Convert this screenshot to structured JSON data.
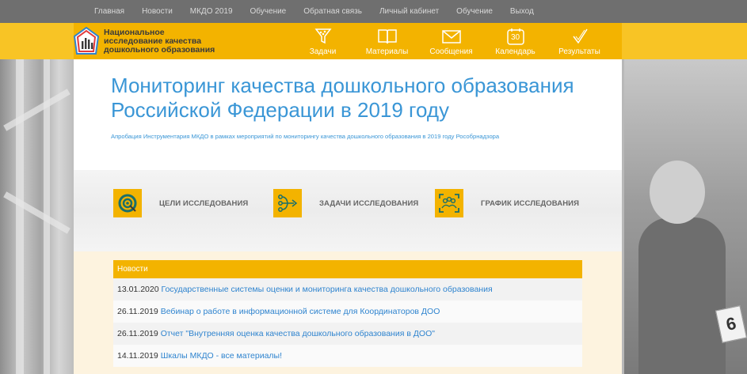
{
  "nav": {
    "links": [
      "Главная",
      "Новости",
      "МКДО 2019",
      "Обучение",
      "Обратная связь",
      "Личный кабинет",
      "Обучение",
      "Выход"
    ]
  },
  "header": {
    "logo_lines": [
      "Национальное",
      "исследование качества",
      "дошкольного образования"
    ],
    "tabs": [
      {
        "label": "Задачи",
        "icon": "funnel-icon"
      },
      {
        "label": "Материалы",
        "icon": "book-icon"
      },
      {
        "label": "Сообщения",
        "icon": "envelope-icon"
      },
      {
        "label": "Календарь",
        "icon": "calendar-icon",
        "icon_text": "30"
      },
      {
        "label": "Результаты",
        "icon": "checkmark-icon"
      }
    ]
  },
  "main": {
    "title": "Мониторинг качества дошкольного образования Российской Федерации в 2019 году",
    "subtitle": "Апробация Инструментария МКДО в рамках мероприятий по мониторингу качества дошкольного образования в 2019 году Рособрнадзора",
    "goals": [
      {
        "label": "ЦЕЛИ ИССЛЕДОВАНИЯ",
        "icon": "target-icon"
      },
      {
        "label": "ЗАДАЧИ ИССЛЕДОВАНИЯ",
        "icon": "flow-icon"
      },
      {
        "label": "ГРАФИК ИССЛЕДОВАНИЯ",
        "icon": "group-icon"
      }
    ]
  },
  "news": {
    "heading": "Новости",
    "items": [
      {
        "date": "13.01.2020",
        "title": "Государственные системы оценки и мониторинга качества дошкольного образования"
      },
      {
        "date": "26.11.2019",
        "title": "Вебинар о работе в информационной системе для Координаторов ДОО"
      },
      {
        "date": "26.11.2019",
        "title": "Отчет \"Внутренняя оценка качества дошкольного образования в ДОО\""
      },
      {
        "date": "14.11.2019",
        "title": "Шкалы МКДО - все материалы!"
      }
    ]
  },
  "background": {
    "block_text": "6"
  },
  "colors": {
    "accent": "#f3b300",
    "title_blue": "#3a96d6",
    "link_blue": "#2f84cf",
    "nav_bg": "#6f6f6f"
  }
}
